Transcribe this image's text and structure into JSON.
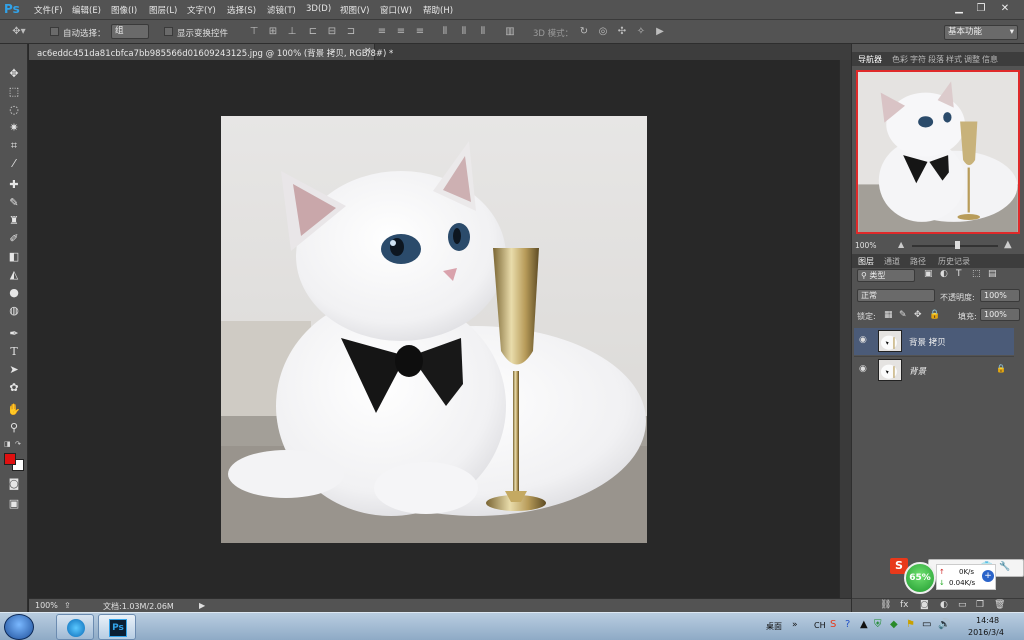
{
  "app": {
    "logo": "Ps"
  },
  "menu": [
    "文件(F)",
    "编辑(E)",
    "图像(I)",
    "图层(L)",
    "文字(Y)",
    "选择(S)",
    "滤镜(T)",
    "3D(D)",
    "视图(V)",
    "窗口(W)",
    "帮助(H)"
  ],
  "window_controls": {
    "minimize": "▁",
    "restore": "❐",
    "close": "✕"
  },
  "options": {
    "auto_select_label": "自动选择：",
    "auto_select_value": "组",
    "show_transform_label": "显示变换控件",
    "mode_3d_label": "3D 模式：",
    "workspace": "基本功能"
  },
  "document": {
    "tab_title": "ac6eddc451da81cbfca7bb985566d01609243125.jpg @ 100% (背景 拷贝, RGB/8#) *",
    "close": "×"
  },
  "status": {
    "zoom": "100%",
    "doc_info": "文档:1.03M/2.06M"
  },
  "panels": {
    "top_tabs": [
      "导航器",
      "色彩",
      "字符",
      "段落",
      "样式",
      "调整",
      "信息"
    ],
    "navigator_zoom": "100%",
    "layer_tabs": [
      "图层",
      "通道",
      "路径",
      "历史记录"
    ],
    "filter_kind": "类型",
    "blend_mode": "正常",
    "opacity_label": "不透明度:",
    "opacity_value": "100%",
    "lock_label": "锁定:",
    "fill_label": "填充:",
    "fill_value": "100%",
    "layers": [
      {
        "name": "背景 拷贝",
        "selected": true,
        "locked": false
      },
      {
        "name": "背景",
        "selected": false,
        "locked": true
      }
    ]
  },
  "speed_widget": {
    "percent": "65%",
    "up": "0K/s",
    "down": "0.04K/s"
  },
  "taskbar": {
    "desktop_label": "桌面",
    "ime": "CH",
    "time": "14:48",
    "date": "2016/3/4"
  },
  "colors": {
    "foreground": "#e01010",
    "background": "#ffffff",
    "accent": "#32a2e8"
  }
}
